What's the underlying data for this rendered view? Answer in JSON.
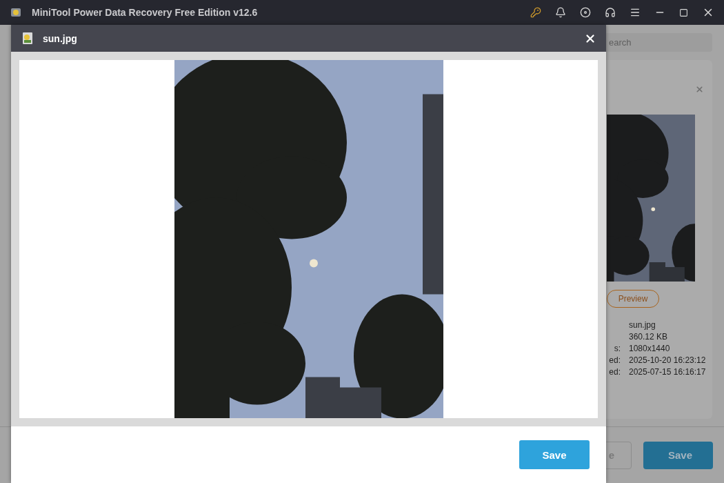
{
  "window": {
    "title": "MiniTool Power Data Recovery Free Edition v12.6"
  },
  "background": {
    "search": {
      "placeholder": "earch"
    },
    "preview_panel": {
      "preview_button": "Preview",
      "details": [
        {
          "value": "sun.jpg"
        },
        {
          "value": "360.12 KB"
        },
        {
          "label": "s:",
          "value": "1080x1440"
        },
        {
          "label": "ed:",
          "value": "2025-10-20 16:23:12"
        },
        {
          "label": "ed:",
          "value": "2025-07-15 16:16:17"
        }
      ]
    },
    "buttons": [
      "e",
      "Save"
    ]
  },
  "dialog": {
    "title": "sun.jpg",
    "save_button": "Save"
  }
}
